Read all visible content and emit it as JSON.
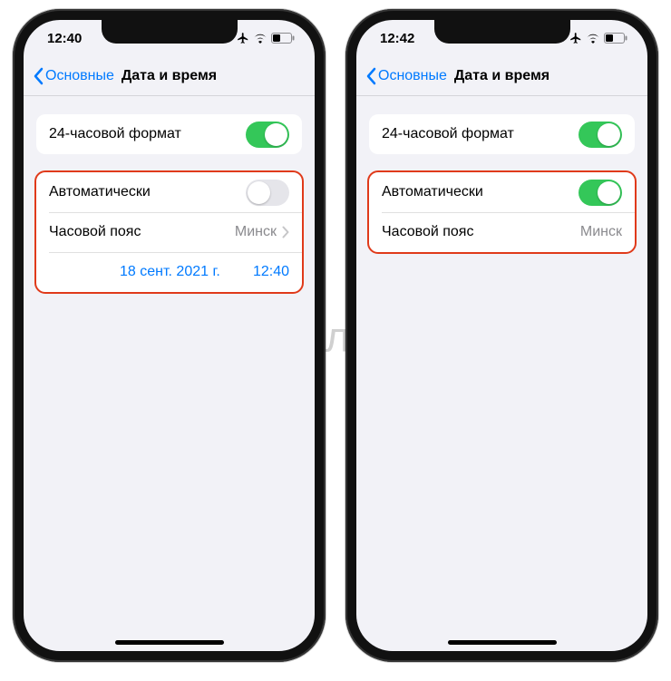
{
  "watermark": "Яблык",
  "phones": [
    {
      "status_time": "12:40",
      "back_label": "Основные",
      "title": "Дата и время",
      "row_24h_label": "24-часовой формат",
      "row_24h_on": true,
      "row_auto_label": "Автоматически",
      "row_auto_on": false,
      "row_tz_label": "Часовой пояс",
      "row_tz_value": "Минск",
      "show_tz_chevron": true,
      "show_datetime_row": true,
      "dt_date": "18 сент. 2021 г.",
      "dt_time": "12:40"
    },
    {
      "status_time": "12:42",
      "back_label": "Основные",
      "title": "Дата и время",
      "row_24h_label": "24-часовой формат",
      "row_24h_on": true,
      "row_auto_label": "Автоматически",
      "row_auto_on": true,
      "row_tz_label": "Часовой пояс",
      "row_tz_value": "Минск",
      "show_tz_chevron": false,
      "show_datetime_row": false,
      "dt_date": "",
      "dt_time": ""
    }
  ]
}
